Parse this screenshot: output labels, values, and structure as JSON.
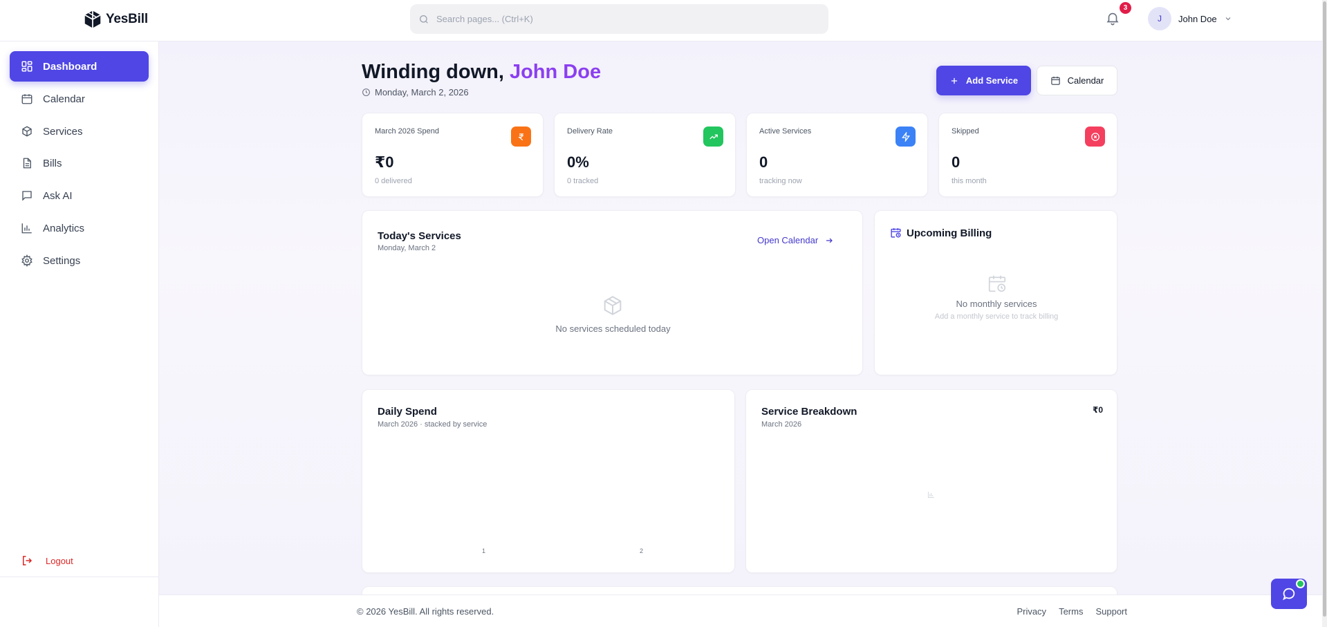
{
  "brand": {
    "name": "YesBill"
  },
  "header": {
    "search_placeholder": "Search pages... (Ctrl+K)",
    "notification_count": "3",
    "user_initial": "J",
    "user_name": "John Doe"
  },
  "sidebar": {
    "items": [
      {
        "label": "Dashboard",
        "icon": "grid-icon"
      },
      {
        "label": "Calendar",
        "icon": "calendar-icon"
      },
      {
        "label": "Services",
        "icon": "box-icon"
      },
      {
        "label": "Bills",
        "icon": "file-icon"
      },
      {
        "label": "Ask AI",
        "icon": "chat-icon"
      },
      {
        "label": "Analytics",
        "icon": "bar-chart-icon"
      },
      {
        "label": "Settings",
        "icon": "gear-icon"
      }
    ],
    "active_index": 0,
    "logout_label": "Logout"
  },
  "page": {
    "greeting_prefix": "Winding down,",
    "greeting_name": "John Doe",
    "date": "Monday, March 2, 2026",
    "add_service_label": "Add Service",
    "calendar_label": "Calendar"
  },
  "stats": [
    {
      "label": "March 2026 Spend",
      "value": "₹0",
      "sub": "0 delivered",
      "icon": "rupee-icon",
      "color": "#f97316"
    },
    {
      "label": "Delivery Rate",
      "value": "0%",
      "sub": "0 tracked",
      "icon": "trending-up-icon",
      "color": "#22c55e"
    },
    {
      "label": "Active Services",
      "value": "0",
      "sub": "tracking now",
      "icon": "bolt-icon",
      "color": "#3b82f6"
    },
    {
      "label": "Skipped",
      "value": "0",
      "sub": "this month",
      "icon": "x-circle-icon",
      "color": "#f43f5e"
    }
  ],
  "todays_services": {
    "title": "Today's Services",
    "subtitle": "Monday, March 2",
    "link": "Open Calendar",
    "empty": "No services scheduled today"
  },
  "upcoming_billing": {
    "title": "Upcoming Billing",
    "empty_title": "No monthly services",
    "empty_sub": "Add a monthly service to track billing"
  },
  "daily_spend": {
    "title": "Daily Spend",
    "subtitle": "March 2026 · stacked by service"
  },
  "service_breakdown": {
    "title": "Service Breakdown",
    "subtitle": "March 2026",
    "total": "₹0"
  },
  "chart_data": {
    "type": "bar",
    "categories": [
      "1",
      "2"
    ],
    "series": [],
    "title": "Daily Spend",
    "xlabel": "",
    "ylabel": ""
  },
  "footer": {
    "copyright": "© 2026 YesBill. All rights reserved.",
    "links": [
      "Privacy",
      "Terms",
      "Support"
    ]
  },
  "colors": {
    "accent": "#4f46e5",
    "name_highlight": "#8b3ff0",
    "logout": "#dc2626"
  }
}
